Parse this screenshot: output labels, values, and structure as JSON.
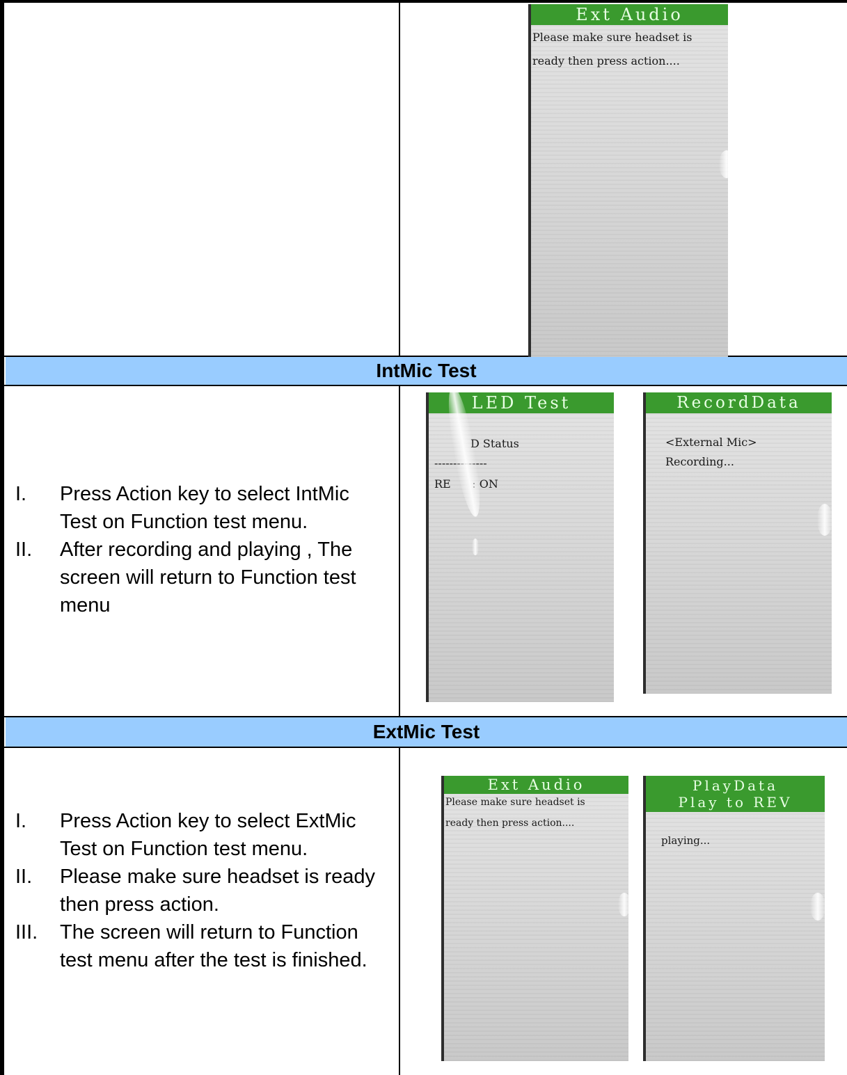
{
  "ext_audio_screen_top": {
    "title": "Ext Audio",
    "line1": "Please make sure headset is",
    "line2": "ready then press action...."
  },
  "intmic_section": {
    "heading": "IntMic Test",
    "steps": [
      {
        "num": "I.",
        "text": "Press Action key to select IntMic Test on Function test menu."
      },
      {
        "num": "II.",
        "text": "After recording and playing , The screen will return to Function test menu"
      }
    ],
    "led_screen": {
      "title": "LED Test",
      "status": "D Status",
      "divider": "--------------",
      "rec": "RE      : ON"
    },
    "record_screen": {
      "title": "RecordData",
      "line1": "<External Mic>",
      "line2": "Recording..."
    }
  },
  "extmic_section": {
    "heading": "ExtMic Test",
    "steps": [
      {
        "num": "I.",
        "text": "Press Action key to select ExtMic Test on Function test menu."
      },
      {
        "num": "II.",
        "text": "Please make sure headset is ready then press action."
      },
      {
        "num": "III.",
        "text": "The screen will return to Function test menu after the test is finished."
      }
    ],
    "ext_audio_screen": {
      "title": "Ext Audio",
      "line1": "Please make sure headset is",
      "line2": "ready then press action...."
    },
    "play_screen": {
      "title1": "PlayData",
      "title2": "Play to REV",
      "line1": "playing..."
    }
  }
}
